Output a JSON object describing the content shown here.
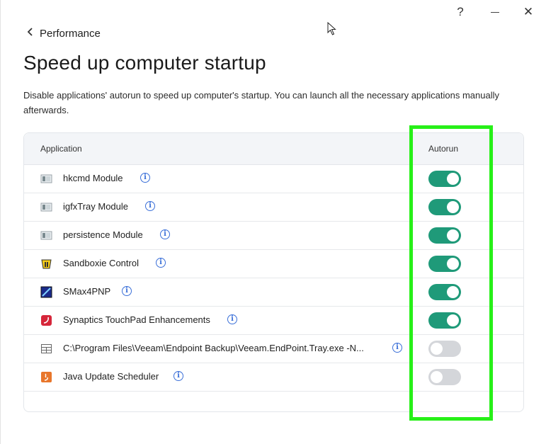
{
  "window": {
    "help_label": "?",
    "close_label": "✕"
  },
  "nav": {
    "back_label": "Performance"
  },
  "page": {
    "title": "Speed up computer startup",
    "description": "Disable applications' autorun to speed up computer's startup. You can launch all the necessary applications manually afterwards."
  },
  "table": {
    "col_application": "Application",
    "col_autorun": "Autorun",
    "rows": [
      {
        "name": "hkcmd Module",
        "icon": "module-icon",
        "autorun": true
      },
      {
        "name": "igfxTray Module",
        "icon": "module-icon",
        "autorun": true
      },
      {
        "name": "persistence Module",
        "icon": "module-icon",
        "autorun": true
      },
      {
        "name": "Sandboxie Control",
        "icon": "sandboxie-icon",
        "autorun": true
      },
      {
        "name": "SMax4PNP",
        "icon": "smax-icon",
        "autorun": true
      },
      {
        "name": "Synaptics TouchPad Enhancements",
        "icon": "synaptics-icon",
        "autorun": true
      },
      {
        "name": "C:\\Program Files\\Veeam\\Endpoint Backup\\Veeam.EndPoint.Tray.exe -N...",
        "icon": "generic-app-icon",
        "autorun": false
      },
      {
        "name": "Java Update Scheduler",
        "icon": "java-icon",
        "autorun": false
      }
    ]
  },
  "colors": {
    "toggle_on": "#1f9a79",
    "toggle_off": "#d4d6da",
    "info": "#3a6fd8",
    "highlight": "#27f018"
  }
}
